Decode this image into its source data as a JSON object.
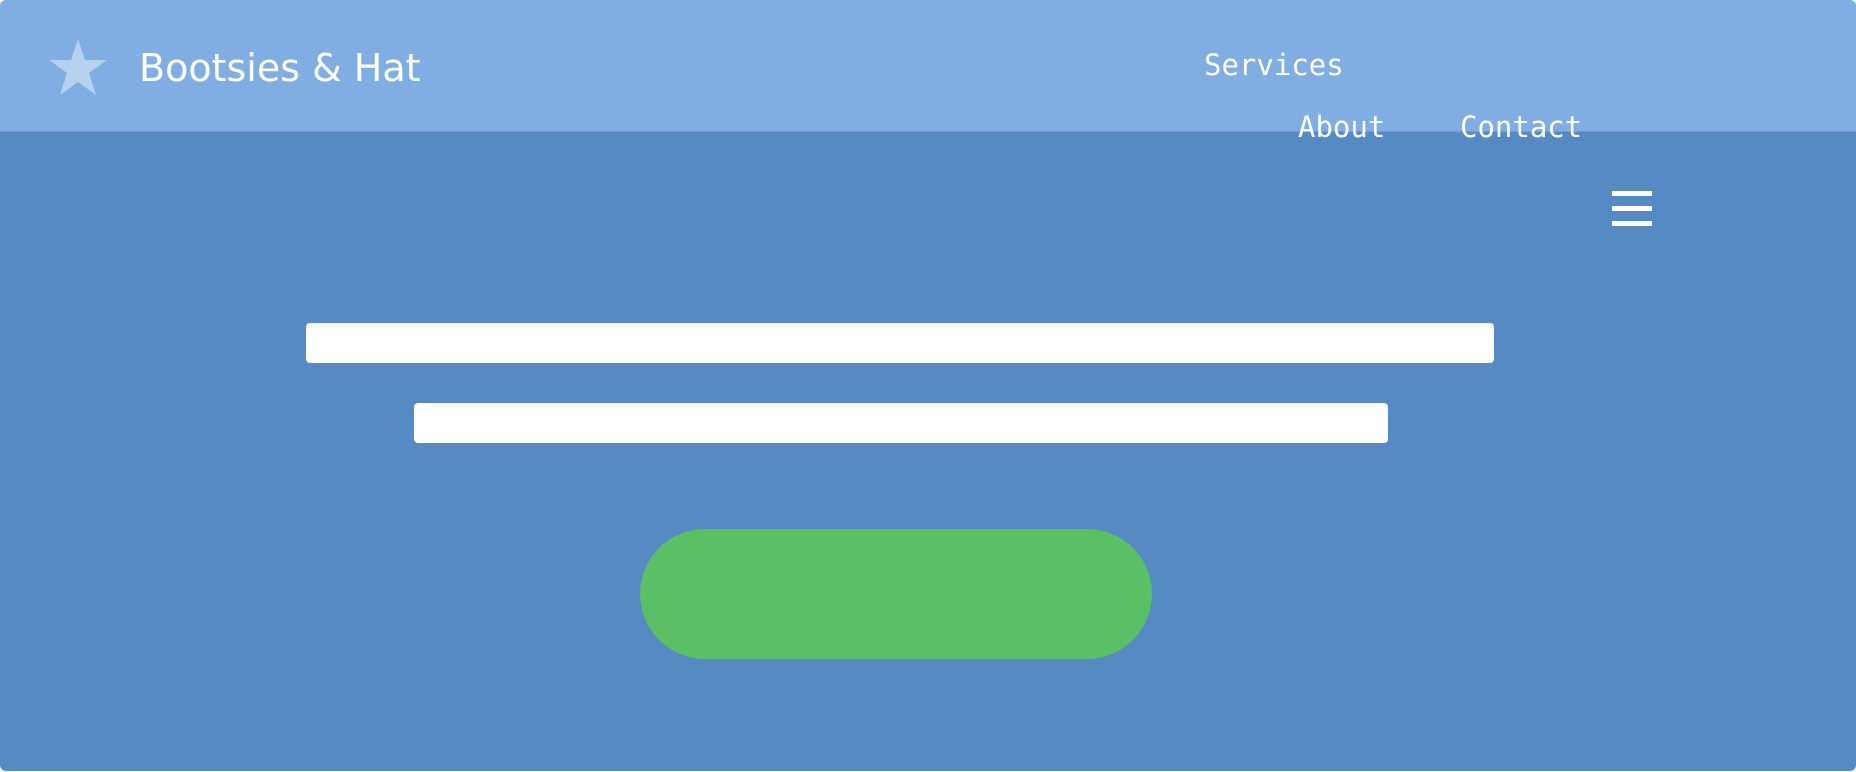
{
  "header": {
    "brand": "Bootsies & Hat",
    "logo_icon": "star-icon",
    "nav": {
      "services": "Services",
      "about": "About",
      "contact": "Contact"
    },
    "menu_icon": "hamburger-menu-icon"
  },
  "hero": {
    "headline_blocks": 2,
    "cta_icon": "none"
  },
  "colors": {
    "header_bg": "#80aee2",
    "page_bg": "#568ac3",
    "cta_bg": "#5bbf66",
    "text": "#ffffff"
  }
}
